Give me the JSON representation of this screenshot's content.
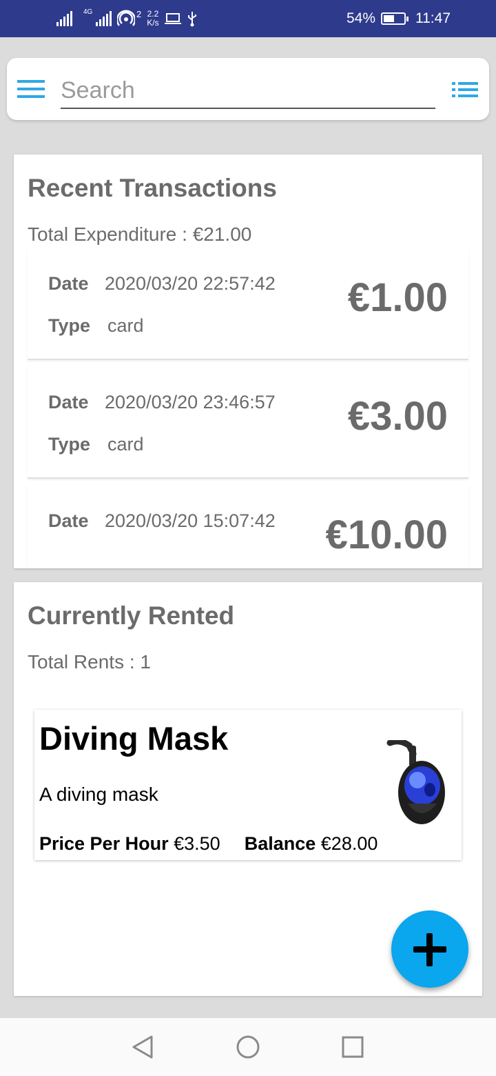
{
  "status_bar": {
    "network": "4G",
    "hotspot_count": "2",
    "speed_value": "2.2",
    "speed_unit": "K/s",
    "battery": "54%",
    "time": "11:47",
    "battery_level": 0.54,
    "icons": [
      "signal-icon",
      "signal-4g-icon",
      "hotspot-icon",
      "laptop-icon",
      "usb-icon",
      "battery-charging-icon"
    ]
  },
  "search": {
    "placeholder": "Search",
    "value": ""
  },
  "transactions": {
    "title": "Recent Transactions",
    "total": "Total Expenditure : €21.00",
    "date_label": "Date",
    "type_label": "Type",
    "items": [
      {
        "date": "2020/03/20 22:57:42",
        "type": "card",
        "amount": "€1.00"
      },
      {
        "date": "2020/03/20 23:46:57",
        "type": "card",
        "amount": "€3.00"
      },
      {
        "date": "2020/03/20 15:07:42",
        "type": "",
        "amount": "€10.00"
      }
    ]
  },
  "rented": {
    "title": "Currently Rented",
    "total": "Total Rents : 1",
    "items": [
      {
        "name": "Diving Mask",
        "description": "A diving mask",
        "price_label": "Price Per Hour",
        "price": "€3.50",
        "balance_label": "Balance",
        "balance": "€28.00"
      }
    ]
  },
  "colors": {
    "status_bar": "#2e3a8c",
    "accent": "#2ea8e6",
    "fab": "#0aa6ee",
    "text_muted": "#6b6b6b"
  }
}
